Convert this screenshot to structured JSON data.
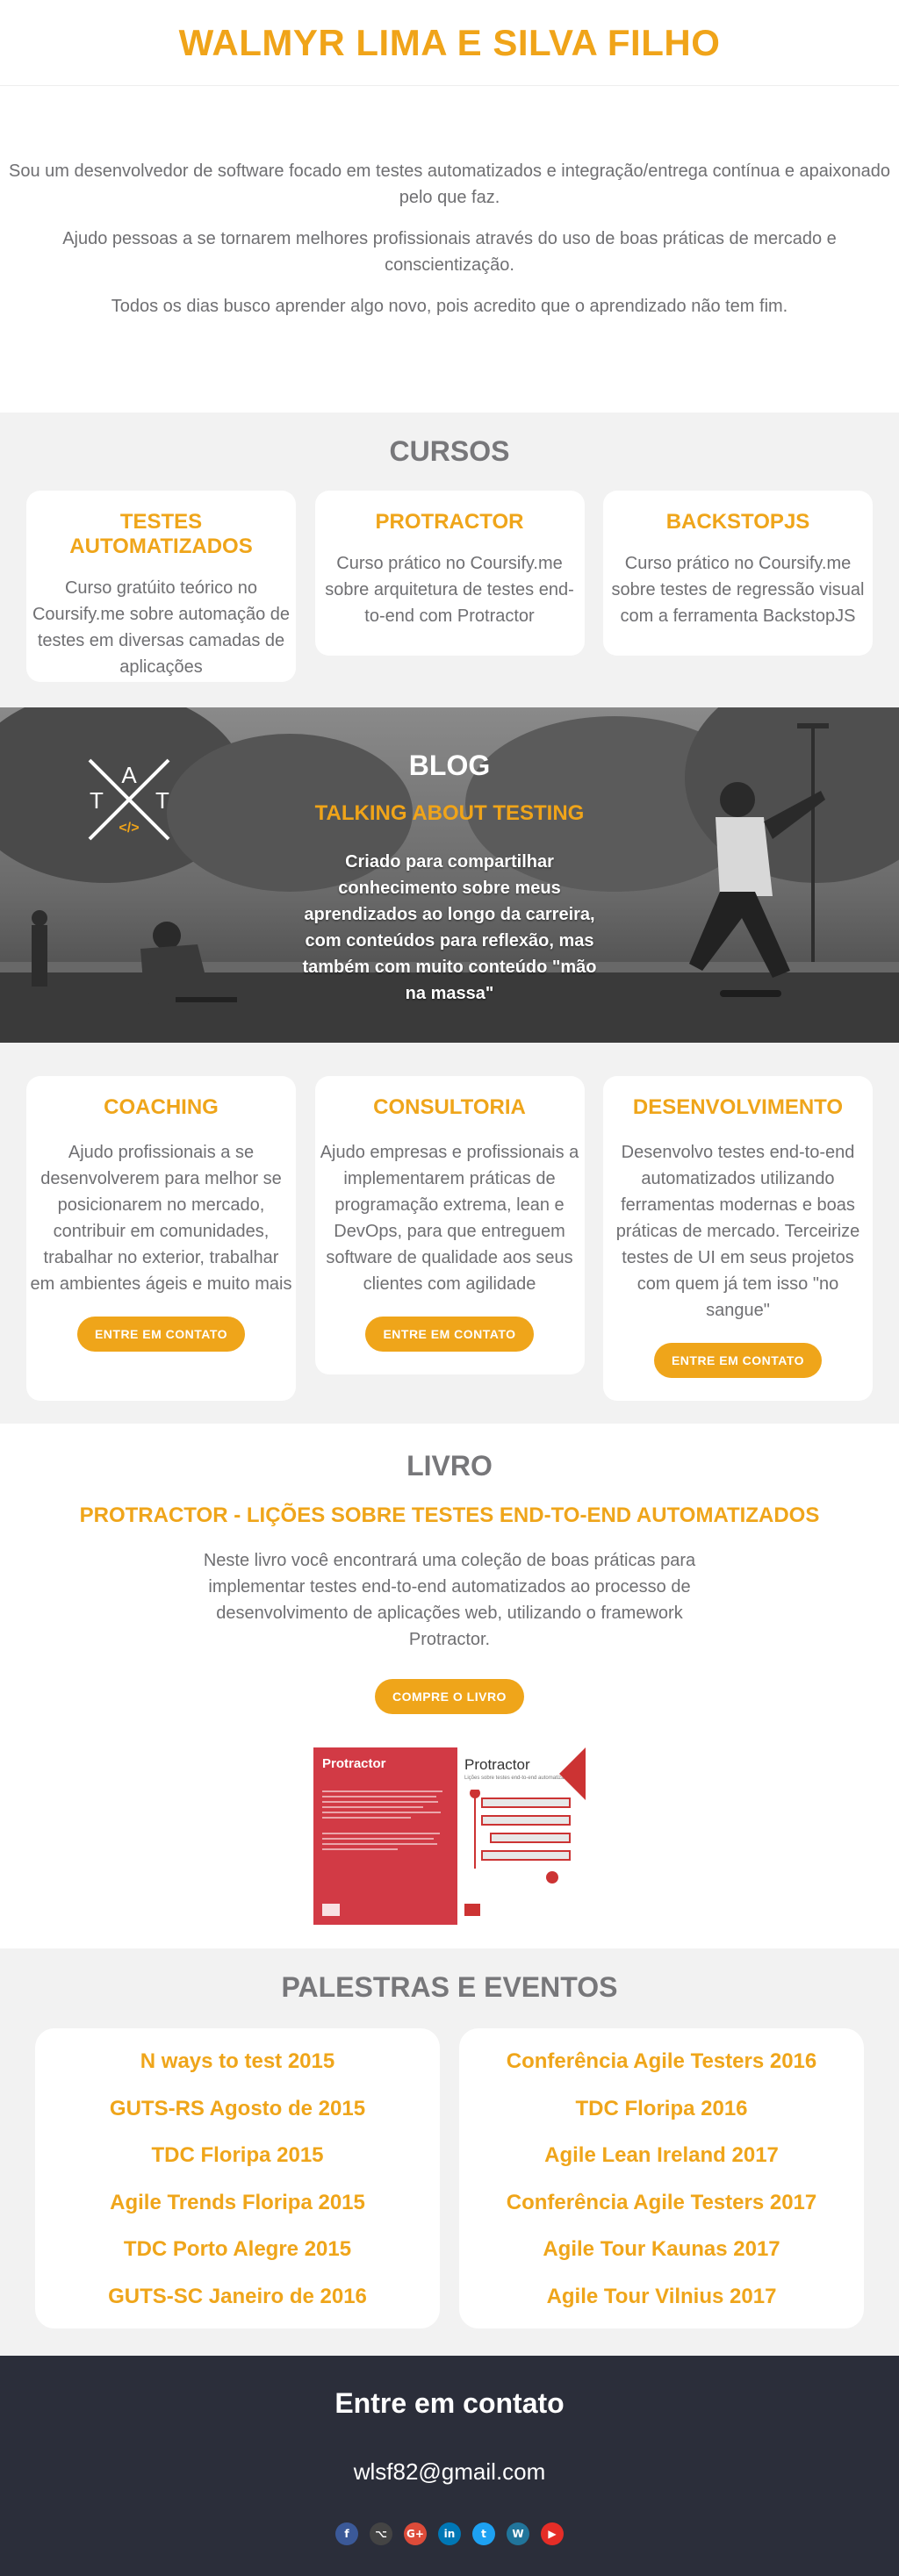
{
  "header": {
    "title": "WALMYR LIMA E SILVA FILHO"
  },
  "about": {
    "p1": "Sou um desenvolvedor de software focado em testes automatizados e integração/entrega contínua e apaixonado pelo que faz.",
    "p2": "Ajudo pessoas a se tornarem melhores profissionais através do uso de boas práticas de mercado e conscientização.",
    "p3": "Todos os dias busco aprender algo novo, pois acredito que o aprendizado não tem fim."
  },
  "cursos": {
    "title": "CURSOS",
    "items": [
      {
        "title": "TESTES AUTOMATIZADOS",
        "text": "Curso gratúito teórico no Coursify.me sobre automação de testes em diversas camadas de aplicações"
      },
      {
        "title": "PROTRACTOR",
        "text": "Curso prático no Coursify.me sobre arquitetura de testes end-to-end com Protractor"
      },
      {
        "title": "BACKSTOPJS",
        "text": "Curso prático no Coursify.me sobre testes de regressão visual com a ferramenta BackstopJS"
      }
    ]
  },
  "blog": {
    "title": "BLOG",
    "subtitle": "TALKING ABOUT TESTING",
    "text": "Criado para compartilhar conhecimento sobre meus aprendizados ao longo da carreira, com conteúdos para reflexão, mas também com muito conteúdo \"mão na massa\"",
    "logo": {
      "letters": [
        "T",
        "A",
        "T"
      ],
      "code": "</>"
    }
  },
  "services": {
    "items": [
      {
        "title": "COACHING",
        "text": "Ajudo profissionais a se desenvolverem para melhor se posicionarem no mercado, contribuir em comunidades, trabalhar no exterior, trabalhar em ambientes ágeis e muito mais",
        "button": "ENTRE EM CONTATO"
      },
      {
        "title": "CONSULTORIA",
        "text": "Ajudo empresas e profissionais a implementarem práticas de programação extrema, lean e DevOps, para que entreguem software de qualidade aos seus clientes com agilidade",
        "button": "ENTRE EM CONTATO"
      },
      {
        "title": "DESENVOLVIMENTO",
        "text": "Desenvolvo testes end-to-end automatizados utilizando ferramentas modernas e boas práticas de mercado. Terceirize testes de UI em seus projetos com quem já tem isso \"no sangue\"",
        "button": "ENTRE EM CONTATO"
      }
    ]
  },
  "livro": {
    "title": "LIVRO",
    "subtitle": "PROTRACTOR - LIÇÕES SOBRE TESTES END-TO-END AUTOMATIZADOS",
    "text": "Neste livro você encontrará uma coleção de boas práticas para implementar testes end-to-end automatizados ao processo de desenvolvimento de aplicações web, utilizando o framework Protractor.",
    "button": "COMPRE O LIVRO",
    "cover_back_title": "Protractor",
    "cover_front_title": "Protractor",
    "cover_subtitle": "Lições sobre testes end-to-end automatizados"
  },
  "palestras": {
    "title": "PALESTRAS E EVENTOS",
    "left": [
      "N ways to test 2015",
      "GUTS-RS Agosto de 2015",
      "TDC Floripa 2015",
      "Agile Trends Floripa 2015",
      "TDC Porto Alegre 2015",
      "GUTS-SC Janeiro de 2016"
    ],
    "right": [
      "Conferência Agile Testers 2016",
      "TDC Floripa 2016",
      "Agile Lean Ireland 2017",
      "Conferência Agile Testers 2017",
      "Agile Tour Kaunas 2017",
      "Agile Tour Vilnius 2017"
    ]
  },
  "footer": {
    "title": "Entre em contato",
    "email": "wlsf82@gmail.com",
    "socials": [
      {
        "icon": "facebook-icon",
        "glyph": "f",
        "color": "#3b5998"
      },
      {
        "icon": "github-icon",
        "glyph": "⌥",
        "color": "#444444"
      },
      {
        "icon": "google-plus-icon",
        "glyph": "G+",
        "color": "#dd4b39"
      },
      {
        "icon": "linkedin-icon",
        "glyph": "in",
        "color": "#0077b5"
      },
      {
        "icon": "twitter-icon",
        "glyph": "t",
        "color": "#1da1f2"
      },
      {
        "icon": "wordpress-icon",
        "glyph": "W",
        "color": "#21759b"
      },
      {
        "icon": "youtube-icon",
        "glyph": "▶",
        "color": "#e52d27"
      }
    ]
  }
}
